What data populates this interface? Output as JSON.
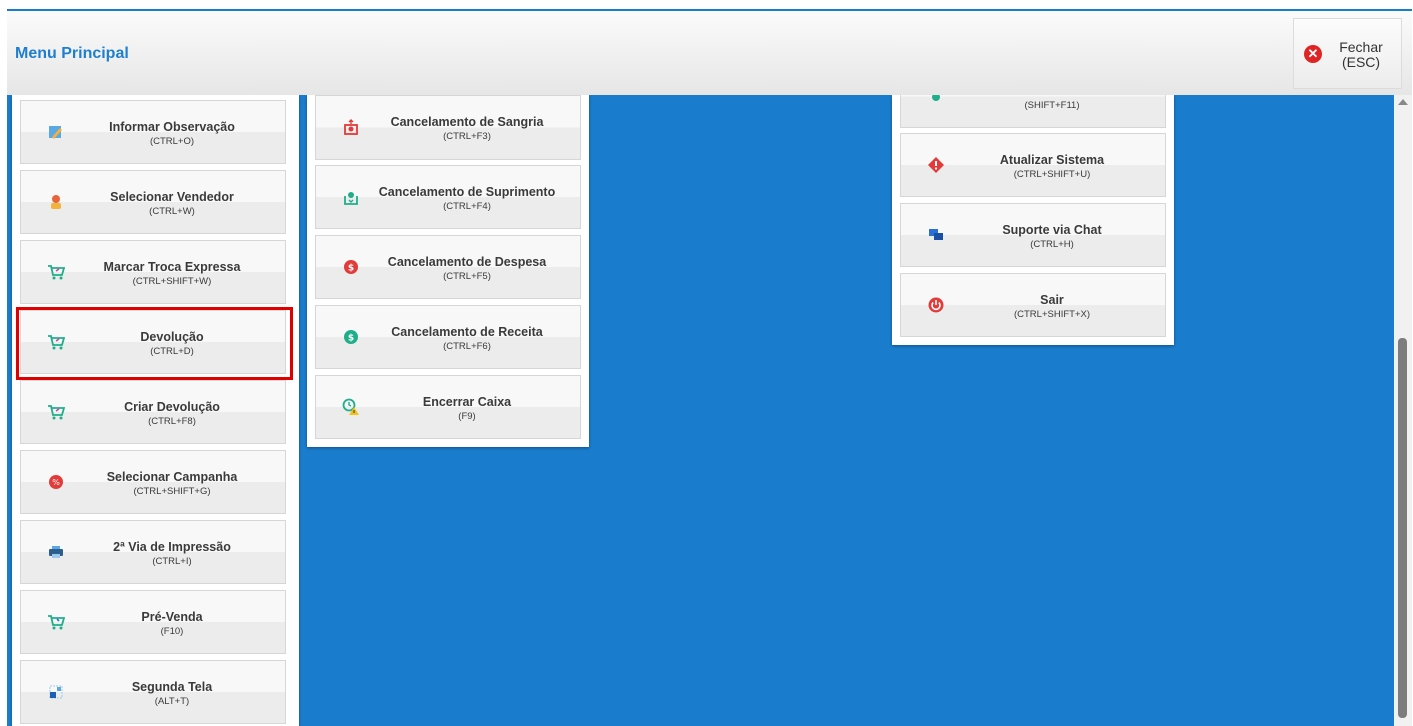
{
  "header": {
    "title": "Menu Principal",
    "close_label": "Fechar\n(ESC)"
  },
  "columns": [
    {
      "items": [
        {
          "label": "Informar Observação",
          "shortcut": "(CTRL+O)",
          "icon": "pencil-note-icon"
        },
        {
          "label": "Selecionar Vendedor",
          "shortcut": "(CTRL+W)",
          "icon": "salesperson-icon"
        },
        {
          "label": "Marcar Troca Expressa",
          "shortcut": "(CTRL+SHIFT+W)",
          "icon": "cart-exchange-icon"
        },
        {
          "label": "Devolução",
          "shortcut": "(CTRL+D)",
          "icon": "cart-return-icon"
        },
        {
          "label": "Criar Devolução",
          "shortcut": "(CTRL+F8)",
          "icon": "cart-return-icon"
        },
        {
          "label": "Selecionar Campanha",
          "shortcut": "(CTRL+SHIFT+G)",
          "icon": "discount-badge-icon"
        },
        {
          "label": "2ª Via de Impressão",
          "shortcut": "(CTRL+I)",
          "icon": "printer-icon"
        },
        {
          "label": "Pré-Venda",
          "shortcut": "(F10)",
          "icon": "cart-add-icon"
        },
        {
          "label": "Segunda Tela",
          "shortcut": "(ALT+T)",
          "icon": "second-screen-icon"
        }
      ]
    },
    {
      "items": [
        {
          "label": "Cancelamento de Sangria",
          "shortcut": "(CTRL+F3)",
          "icon": "withdrawal-icon"
        },
        {
          "label": "Cancelamento de Suprimento",
          "shortcut": "(CTRL+F4)",
          "icon": "supply-icon"
        },
        {
          "label": "Cancelamento de Despesa",
          "shortcut": "(CTRL+F5)",
          "icon": "expense-icon"
        },
        {
          "label": "Cancelamento de Receita",
          "shortcut": "(CTRL+F6)",
          "icon": "income-icon"
        },
        {
          "label": "Encerrar Caixa",
          "shortcut": "(F9)",
          "icon": "close-register-icon"
        }
      ]
    },
    {
      "items": [
        {
          "label": "",
          "shortcut": "(SHIFT+F11)",
          "icon": "gear-icon"
        },
        {
          "label": "Atualizar Sistema",
          "shortcut": "(CTRL+SHIFT+U)",
          "icon": "update-alert-icon"
        },
        {
          "label": "Suporte via Chat",
          "shortcut": "(CTRL+H)",
          "icon": "chat-icon"
        },
        {
          "label": "Sair",
          "shortcut": "(CTRL+SHIFT+X)",
          "icon": "power-icon"
        }
      ]
    }
  ],
  "colors": {
    "accent": "#1a7ccc",
    "title": "#1e7fd0",
    "highlight": "#e00000"
  }
}
